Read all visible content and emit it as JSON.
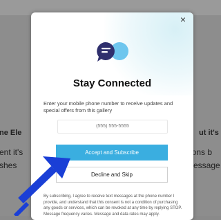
{
  "background": {
    "left_text_1": "ne Ele",
    "left_text_2": "ent it's",
    "left_text_3": "shes",
    "right_text_1": "ut it's",
    "right_text_2": "ions b",
    "right_text_3": "essage"
  },
  "modal": {
    "close_label": "×",
    "title": "Stay Connected",
    "description": "Enter your mobile phone number to receive updates and special offers from this gallery",
    "phone_placeholder": "(555) 555-5555",
    "accept_label": "Accept and Subscribe",
    "decline_label": "Decline and Skip",
    "legal_text": "By subscribing, I agree to receive text messages at the phone number I provide, and understand that this consent is not a condition of purchasing any goods or services, which can be revoked at any time by replying STOP. Message frequency varies. Message and data rates may apply."
  },
  "colors": {
    "accent": "#3aaee0",
    "logo_dark": "#2f2f6d",
    "logo_light": "#6ec6ee",
    "annotation_arrow": "#1a3fd6"
  },
  "icons": [
    "chat-bubbles-logo-icon",
    "close-icon",
    "annotation-arrow-icon"
  ]
}
